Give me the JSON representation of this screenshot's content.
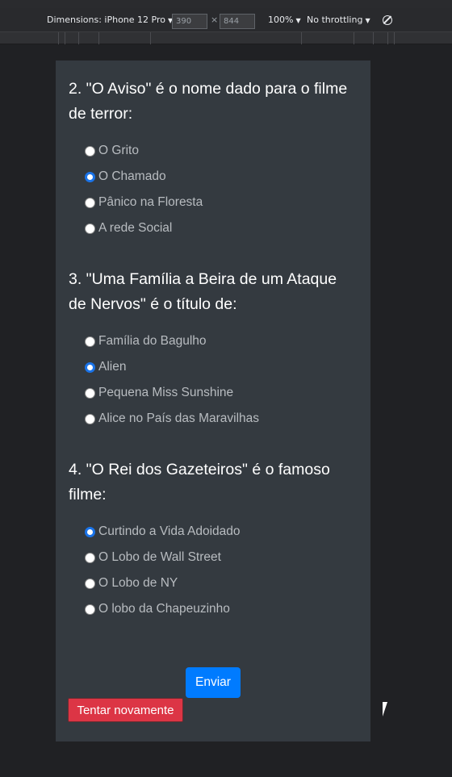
{
  "devtools": {
    "dimensions_label": "Dimensions: iPhone 12 Pro",
    "width_value": "390",
    "times_symbol": "×",
    "height_value": "844",
    "zoom": "100%",
    "throttling": "No throttling",
    "caret": "▼"
  },
  "questions": [
    {
      "title": "2. \"O Aviso\" é o nome dado para o filme de terror:",
      "options": [
        {
          "label": "O Grito",
          "checked": false
        },
        {
          "label": "O Chamado",
          "checked": true
        },
        {
          "label": "Pânico na Floresta",
          "checked": false
        },
        {
          "label": "A rede Social",
          "checked": false
        }
      ]
    },
    {
      "title": "3. \"Uma Família a Beira de um Ataque de Nervos\" é o título de:",
      "options": [
        {
          "label": "Família do Bagulho",
          "checked": false
        },
        {
          "label": "Alien",
          "checked": true
        },
        {
          "label": "Pequena Miss Sunshine",
          "checked": false
        },
        {
          "label": "Alice no País das Maravilhas",
          "checked": false
        }
      ]
    },
    {
      "title": "4. \"O Rei dos Gazeteiros\" é o famoso filme:",
      "options": [
        {
          "label": "Curtindo a Vida Adoidado",
          "checked": true
        },
        {
          "label": "O Lobo de Wall Street",
          "checked": false
        },
        {
          "label": "O Lobo de NY",
          "checked": false
        },
        {
          "label": "O lobo da Chapeuzinho",
          "checked": false
        }
      ]
    }
  ],
  "buttons": {
    "submit": "Enviar",
    "retry": "Tentar novamente"
  },
  "colors": {
    "card_bg": "#343a40",
    "primary": "#007bff",
    "danger": "#dc3545"
  }
}
